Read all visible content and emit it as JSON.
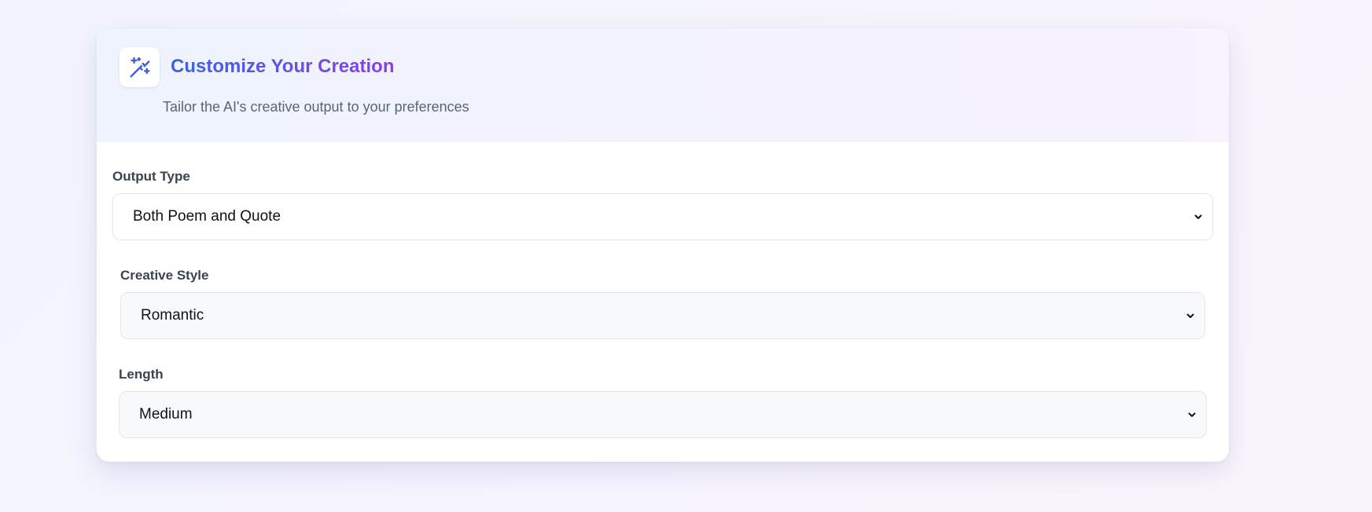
{
  "header": {
    "icon": "magic-wand-icon",
    "title": "Customize Your Creation",
    "subtitle": "Tailor the AI's creative output to your preferences"
  },
  "fields": [
    {
      "label": "Output Type",
      "selected": "Both Poem and Quote"
    },
    {
      "label": "Creative Style",
      "selected": "Romantic"
    },
    {
      "label": "Length",
      "selected": "Medium"
    }
  ],
  "colors": {
    "title_gradient_start": "#3b63e3",
    "title_gradient_end": "#8b3fe0",
    "icon_color": "#4360e0"
  }
}
